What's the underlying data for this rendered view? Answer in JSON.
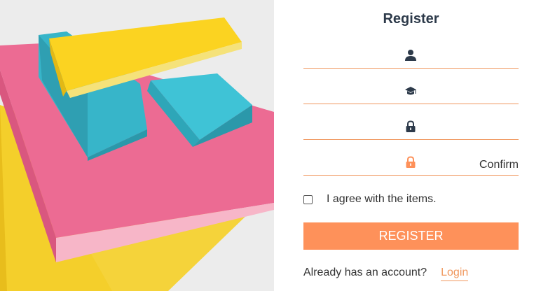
{
  "form": {
    "title": "Register",
    "fields": [
      {
        "icon": "user-icon",
        "placeholder": ""
      },
      {
        "icon": "graduation-cap-icon",
        "placeholder": ""
      },
      {
        "icon": "lock-icon",
        "placeholder": ""
      },
      {
        "icon": "unlock-icon",
        "placeholder": "",
        "hint": "Confirm"
      }
    ],
    "agree_label": "I agree with the items.",
    "agree_checked": false,
    "submit_label": "REGISTER",
    "footer_text": "Already has an account?",
    "login_link": "Login"
  },
  "colors": {
    "accent": "#fe915a",
    "underline": "#f0975d",
    "title": "#2d3a4a",
    "icon_dark": "#2d3a4a",
    "icon_accent": "#fe915a"
  },
  "hero_image": "sticky-notes-stack"
}
